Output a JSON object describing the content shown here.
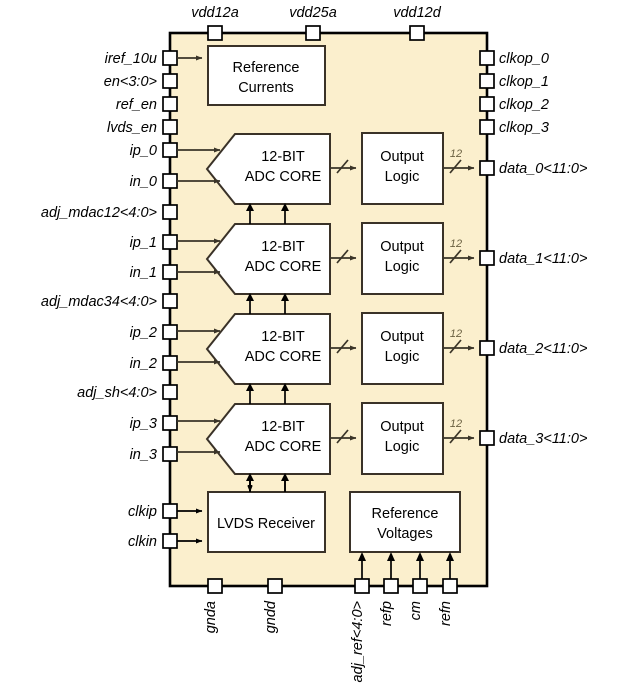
{
  "figure": {
    "kind": "block-diagram",
    "title": "Quad 12-bit ADC chip block diagram",
    "chip_fill": "#fbefcd",
    "block_fill": "#ffffff",
    "line_color": "#3a3428",
    "bus_label_color": "#6b6142"
  },
  "blocks": [
    {
      "id": "reference-currents",
      "line1": "Reference",
      "line2": "Currents",
      "shape": "rect"
    },
    {
      "id": "adc-core-0",
      "line1": "12-BIT",
      "line2": "ADC CORE",
      "shape": "pentagon"
    },
    {
      "id": "adc-core-1",
      "line1": "12-BIT",
      "line2": "ADC CORE",
      "shape": "pentagon"
    },
    {
      "id": "adc-core-2",
      "line1": "12-BIT",
      "line2": "ADC CORE",
      "shape": "pentagon"
    },
    {
      "id": "adc-core-3",
      "line1": "12-BIT",
      "line2": "ADC CORE",
      "shape": "pentagon"
    },
    {
      "id": "output-logic-0",
      "line1": "Output",
      "line2": "Logic",
      "shape": "rect"
    },
    {
      "id": "output-logic-1",
      "line1": "Output",
      "line2": "Logic",
      "shape": "rect"
    },
    {
      "id": "output-logic-2",
      "line1": "Output",
      "line2": "Logic",
      "shape": "rect"
    },
    {
      "id": "output-logic-3",
      "line1": "Output",
      "line2": "Logic",
      "shape": "rect"
    },
    {
      "id": "lvds-receiver",
      "line1": "LVDS Receiver",
      "line2": "",
      "shape": "rect"
    },
    {
      "id": "reference-voltages",
      "line1": "Reference",
      "line2": "Voltages",
      "shape": "rect"
    }
  ],
  "pins": {
    "top": [
      {
        "id": "vdd12a",
        "label": "vdd12a"
      },
      {
        "id": "vdd25a",
        "label": "vdd25a"
      },
      {
        "id": "vdd12d",
        "label": "vdd12d"
      }
    ],
    "left": [
      {
        "id": "iref_10u",
        "label": "iref_10u"
      },
      {
        "id": "en_3_0",
        "label": "en<3:0>"
      },
      {
        "id": "ref_en",
        "label": "ref_en"
      },
      {
        "id": "lvds_en",
        "label": "lvds_en"
      },
      {
        "id": "ip_0",
        "label": "ip_0"
      },
      {
        "id": "in_0",
        "label": "in_0"
      },
      {
        "id": "adj_mdac12_4_0",
        "label": "adj_mdac12<4:0>"
      },
      {
        "id": "ip_1",
        "label": "ip_1"
      },
      {
        "id": "in_1",
        "label": "in_1"
      },
      {
        "id": "adj_mdac34_4_0",
        "label": "adj_mdac34<4:0>"
      },
      {
        "id": "ip_2",
        "label": "ip_2"
      },
      {
        "id": "in_2",
        "label": "in_2"
      },
      {
        "id": "adj_sh_4_0",
        "label": "adj_sh<4:0>"
      },
      {
        "id": "ip_3",
        "label": "ip_3"
      },
      {
        "id": "in_3",
        "label": "in_3"
      },
      {
        "id": "clkip",
        "label": "clkip"
      },
      {
        "id": "clkin",
        "label": "clkin"
      }
    ],
    "right": [
      {
        "id": "clkop_0",
        "label": "clkop_0"
      },
      {
        "id": "clkop_1",
        "label": "clkop_1"
      },
      {
        "id": "clkop_2",
        "label": "clkop_2"
      },
      {
        "id": "clkop_3",
        "label": "clkop_3"
      },
      {
        "id": "data_0",
        "label": "data_0<11:0>"
      },
      {
        "id": "data_1",
        "label": "data_1<11:0>"
      },
      {
        "id": "data_2",
        "label": "data_2<11:0>"
      },
      {
        "id": "data_3",
        "label": "data_3<11:0>"
      }
    ],
    "bottom": [
      {
        "id": "gnda",
        "label": "gnda"
      },
      {
        "id": "gndd",
        "label": "gndd"
      },
      {
        "id": "adj_ref_4_0",
        "label": "adj_ref<4:0>"
      },
      {
        "id": "refp",
        "label": "refp"
      },
      {
        "id": "cm",
        "label": "cm"
      },
      {
        "id": "refn",
        "label": "refn"
      }
    ]
  },
  "bus_widths": {
    "data_bus": "12"
  }
}
